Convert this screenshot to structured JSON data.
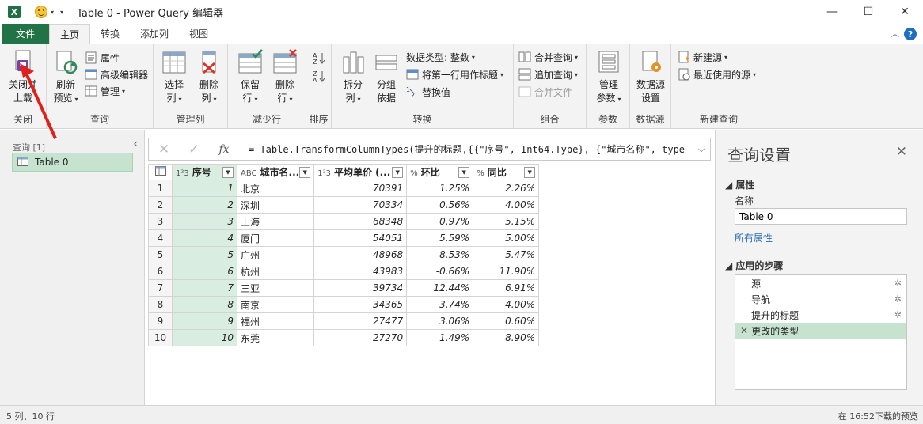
{
  "title_bar": {
    "excel_icon": "excel-icon",
    "window_title": "Table 0 - Power Query 编辑器",
    "minimize": "—",
    "maximize": "☐",
    "close": "✕"
  },
  "tabs": [
    {
      "label": "文件"
    },
    {
      "label": "主页"
    },
    {
      "label": "转换"
    },
    {
      "label": "添加列"
    },
    {
      "label": "视图"
    }
  ],
  "ribbon": {
    "close_group": {
      "label": "关闭",
      "close_load_line1": "关闭并",
      "close_load_line2": "上载"
    },
    "query_group": {
      "label": "查询",
      "refresh_line1": "刷新",
      "refresh_line2": "预览",
      "properties": "属性",
      "advanced_editor": "高级编辑器",
      "manage": "管理"
    },
    "manage_columns_group": {
      "label": "管理列",
      "choose_line1": "选择",
      "choose_line2": "列",
      "remove_line1": "删除",
      "remove_line2": "列"
    },
    "reduce_rows_group": {
      "label": "减少行",
      "keep_line1": "保留",
      "keep_line2": "行",
      "remove_line1": "删除",
      "remove_line2": "行"
    },
    "sort_group": {
      "label": "排序"
    },
    "transform_group": {
      "label": "转换",
      "split_line1": "拆分",
      "split_line2": "列",
      "group_line1": "分组",
      "group_line2": "依据",
      "data_type": "数据类型: 整数",
      "first_row_header": "将第一行用作标题",
      "replace_values": "替换值"
    },
    "combine_group": {
      "label": "组合",
      "merge_queries": "合并查询",
      "append_queries": "追加查询",
      "combine_files": "合并文件"
    },
    "params_group": {
      "label": "参数",
      "manage_line1": "管理",
      "manage_line2": "参数"
    },
    "datasource_group": {
      "label": "数据源",
      "settings_line1": "数据源",
      "settings_line2": "设置"
    },
    "new_query_group": {
      "label": "新建查询",
      "new_source": "新建源",
      "recent_sources": "最近使用的源"
    }
  },
  "left_panel": {
    "queries_label": "查询 [1]",
    "collapse": "‹",
    "query_name": "Table 0"
  },
  "formula_bar": {
    "cancel": "✕",
    "commit": "✓",
    "fx": "fx",
    "formula": "= Table.TransformColumnTypes(提升的标题,{{\"序号\", Int64.Type}, {\"城市名称\", type",
    "expand": "⌵"
  },
  "grid": {
    "columns": [
      {
        "type_icon": "1²3",
        "name": "序号"
      },
      {
        "type_icon": "ABC",
        "name": "城市名..."
      },
      {
        "type_icon": "1²3",
        "name": "平均单价 (..."
      },
      {
        "type_icon": "%",
        "name": "环比"
      },
      {
        "type_icon": "%",
        "name": "同比"
      }
    ],
    "rows": [
      [
        "1",
        "1",
        "北京",
        "70391",
        "1.25%",
        "2.26%"
      ],
      [
        "2",
        "2",
        "深圳",
        "70334",
        "0.56%",
        "4.00%"
      ],
      [
        "3",
        "3",
        "上海",
        "68348",
        "0.97%",
        "5.15%"
      ],
      [
        "4",
        "4",
        "厦门",
        "54051",
        "5.59%",
        "5.00%"
      ],
      [
        "5",
        "5",
        "广州",
        "48968",
        "8.53%",
        "5.47%"
      ],
      [
        "6",
        "6",
        "杭州",
        "43983",
        "-0.66%",
        "11.90%"
      ],
      [
        "7",
        "7",
        "三亚",
        "39734",
        "12.44%",
        "6.91%"
      ],
      [
        "8",
        "8",
        "南京",
        "34365",
        "-3.74%",
        "-4.00%"
      ],
      [
        "9",
        "9",
        "福州",
        "27477",
        "3.06%",
        "0.60%"
      ],
      [
        "10",
        "10",
        "东莞",
        "27270",
        "1.49%",
        "8.90%"
      ]
    ]
  },
  "right_panel": {
    "title": "查询设置",
    "close": "✕",
    "properties_header": "◢ 属性",
    "name_label": "名称",
    "name_value": "Table 0",
    "all_properties": "所有属性",
    "steps_header": "◢ 应用的步骤",
    "steps": [
      {
        "label": "源"
      },
      {
        "label": "导航"
      },
      {
        "label": "提升的标题"
      },
      {
        "label": "更改的类型"
      }
    ]
  },
  "status_bar": {
    "left": "5 列、10 行",
    "right": "在 16:52下载的预览"
  },
  "colors": {
    "accent": "#217346",
    "selection": "#c6e3cf",
    "arrow": "#e0201a"
  }
}
